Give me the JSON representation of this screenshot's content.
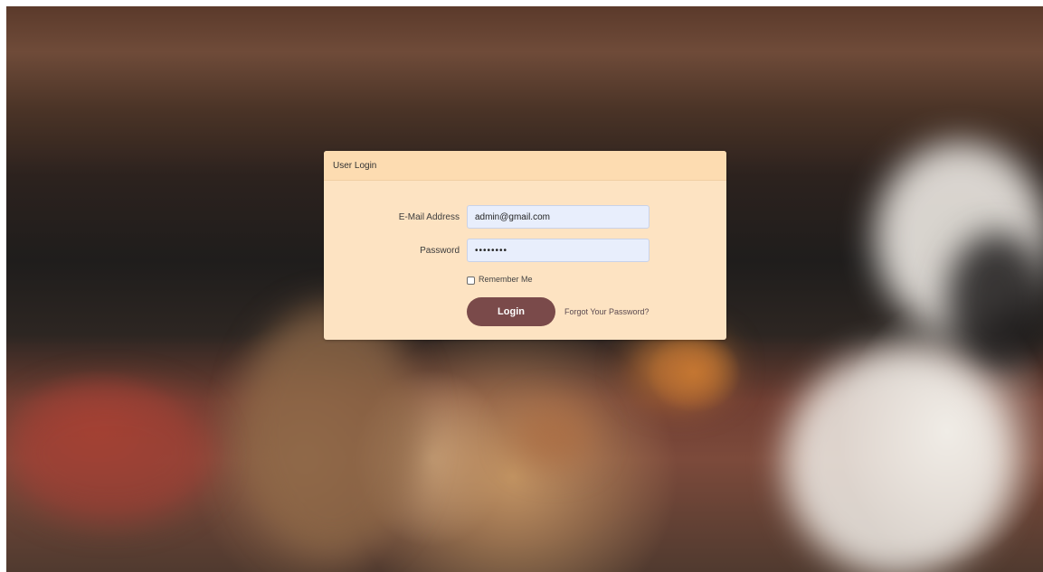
{
  "login": {
    "header_title": "User Login",
    "email_label": "E-Mail Address",
    "email_value": "admin@gmail.com",
    "password_label": "Password",
    "password_value": "••••••••",
    "remember_label": "Remember Me",
    "remember_checked": false,
    "login_button": "Login",
    "forgot_link": "Forgot Your Password?"
  },
  "colors": {
    "card_bg": "#fde3c2",
    "header_bg": "#fddcb1",
    "input_bg": "#e8eefc",
    "button_bg": "#7a4a4a"
  }
}
